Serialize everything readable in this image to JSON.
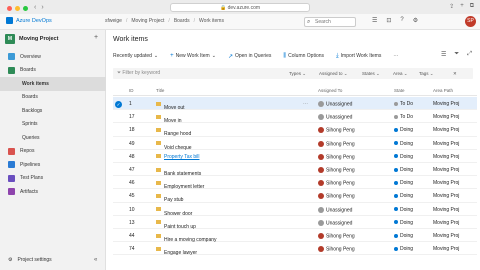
{
  "browser": {
    "url": "dev.azure.com"
  },
  "topbar": {
    "logo_text": "Azure DevOps",
    "breadcrumb": [
      "sfweige",
      "Moving Project",
      "Boards",
      "Work items"
    ],
    "search_placeholder": "Search",
    "avatar_initials": "SP"
  },
  "sidebar": {
    "project_initial": "M",
    "project_name": "Moving Project",
    "items": [
      {
        "label": "Overview",
        "color": "#3c9ad6",
        "sub": false
      },
      {
        "label": "Boards",
        "color": "#2e8b57",
        "sub": false
      },
      {
        "label": "Work items",
        "color": "",
        "sub": true,
        "active": true
      },
      {
        "label": "Boards",
        "color": "",
        "sub": true
      },
      {
        "label": "Backlogs",
        "color": "",
        "sub": true
      },
      {
        "label": "Sprints",
        "color": "",
        "sub": true
      },
      {
        "label": "Queries",
        "color": "",
        "sub": true
      },
      {
        "label": "Repos",
        "color": "#d9534f",
        "sub": false
      },
      {
        "label": "Pipelines",
        "color": "#2a7bd4",
        "sub": false
      },
      {
        "label": "Test Plans",
        "color": "#6a4fbf",
        "sub": false
      },
      {
        "label": "Artifacts",
        "color": "#8e44ad",
        "sub": false
      }
    ],
    "settings_label": "Project settings"
  },
  "main": {
    "title": "Work items",
    "toolbar": {
      "view": "Recently updated",
      "new": "New Work Item",
      "open_query": "Open in Queries",
      "column_options": "Column Options",
      "import": "Import Work Items"
    },
    "filter": {
      "placeholder": "Filter by keyword",
      "types": "Types",
      "assigned": "Assigned to",
      "states": "States",
      "area": "Area",
      "tags": "Tags"
    },
    "columns": {
      "id": "ID",
      "title": "Title",
      "assigned": "Assigned To",
      "state": "State",
      "area": "Area Path"
    },
    "rows": [
      {
        "id": "1",
        "title": "Move out",
        "assigned": "Unassigned",
        "state": "To Do",
        "area": "Moving Proj",
        "sel": true,
        "link": false,
        "assignee_type": "grey",
        "state_type": "todo"
      },
      {
        "id": "17",
        "title": "Move in",
        "assigned": "Unassigned",
        "state": "To Do",
        "area": "Moving Proj",
        "sel": false,
        "link": false,
        "assignee_type": "grey",
        "state_type": "todo"
      },
      {
        "id": "18",
        "title": "Range hood",
        "assigned": "Sihong Peng",
        "state": "Doing",
        "area": "Moving Proj",
        "sel": false,
        "link": false,
        "assignee_type": "red",
        "state_type": "doing"
      },
      {
        "id": "49",
        "title": "Void cheque",
        "assigned": "Sihong Peng",
        "state": "Doing",
        "area": "Moving Proj",
        "sel": false,
        "link": false,
        "assignee_type": "red",
        "state_type": "doing"
      },
      {
        "id": "48",
        "title": "Property Tax bill",
        "assigned": "Sihong Peng",
        "state": "Doing",
        "area": "Moving Proj",
        "sel": false,
        "link": true,
        "assignee_type": "red",
        "state_type": "doing"
      },
      {
        "id": "47",
        "title": "Bank statements",
        "assigned": "Sihong Peng",
        "state": "Doing",
        "area": "Moving Proj",
        "sel": false,
        "link": false,
        "assignee_type": "red",
        "state_type": "doing"
      },
      {
        "id": "46",
        "title": "Employment letter",
        "assigned": "Sihong Peng",
        "state": "Doing",
        "area": "Moving Proj",
        "sel": false,
        "link": false,
        "assignee_type": "red",
        "state_type": "doing"
      },
      {
        "id": "45",
        "title": "Pay stub",
        "assigned": "Sihong Peng",
        "state": "Doing",
        "area": "Moving Proj",
        "sel": false,
        "link": false,
        "assignee_type": "red",
        "state_type": "doing"
      },
      {
        "id": "10",
        "title": "Shower door",
        "assigned": "Unassigned",
        "state": "Doing",
        "area": "Moving Proj",
        "sel": false,
        "link": false,
        "assignee_type": "grey",
        "state_type": "doing"
      },
      {
        "id": "13",
        "title": "Paint touch up",
        "assigned": "Unassigned",
        "state": "Doing",
        "area": "Moving Proj",
        "sel": false,
        "link": false,
        "assignee_type": "grey",
        "state_type": "doing"
      },
      {
        "id": "44",
        "title": "Hire a moving company",
        "assigned": "Sihong Peng",
        "state": "Doing",
        "area": "Moving Proj",
        "sel": false,
        "link": false,
        "assignee_type": "red",
        "state_type": "doing"
      },
      {
        "id": "74",
        "title": "Engage lawyer",
        "assigned": "Sihong Peng",
        "state": "Doing",
        "area": "Moving Proj",
        "sel": false,
        "link": false,
        "assignee_type": "red",
        "state_type": "doing"
      }
    ]
  }
}
